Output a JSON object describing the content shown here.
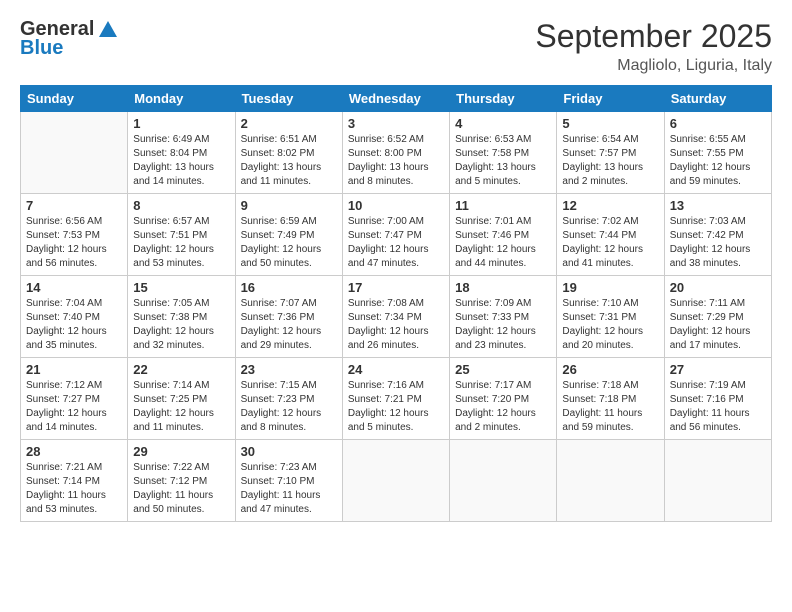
{
  "app": {
    "logo_general": "General",
    "logo_blue": "Blue",
    "month": "September 2025",
    "location": "Magliolo, Liguria, Italy"
  },
  "days_of_week": [
    "Sunday",
    "Monday",
    "Tuesday",
    "Wednesday",
    "Thursday",
    "Friday",
    "Saturday"
  ],
  "weeks": [
    [
      {
        "day": "",
        "info": ""
      },
      {
        "day": "1",
        "info": "Sunrise: 6:49 AM\nSunset: 8:04 PM\nDaylight: 13 hours\nand 14 minutes."
      },
      {
        "day": "2",
        "info": "Sunrise: 6:51 AM\nSunset: 8:02 PM\nDaylight: 13 hours\nand 11 minutes."
      },
      {
        "day": "3",
        "info": "Sunrise: 6:52 AM\nSunset: 8:00 PM\nDaylight: 13 hours\nand 8 minutes."
      },
      {
        "day": "4",
        "info": "Sunrise: 6:53 AM\nSunset: 7:58 PM\nDaylight: 13 hours\nand 5 minutes."
      },
      {
        "day": "5",
        "info": "Sunrise: 6:54 AM\nSunset: 7:57 PM\nDaylight: 13 hours\nand 2 minutes."
      },
      {
        "day": "6",
        "info": "Sunrise: 6:55 AM\nSunset: 7:55 PM\nDaylight: 12 hours\nand 59 minutes."
      }
    ],
    [
      {
        "day": "7",
        "info": "Sunrise: 6:56 AM\nSunset: 7:53 PM\nDaylight: 12 hours\nand 56 minutes."
      },
      {
        "day": "8",
        "info": "Sunrise: 6:57 AM\nSunset: 7:51 PM\nDaylight: 12 hours\nand 53 minutes."
      },
      {
        "day": "9",
        "info": "Sunrise: 6:59 AM\nSunset: 7:49 PM\nDaylight: 12 hours\nand 50 minutes."
      },
      {
        "day": "10",
        "info": "Sunrise: 7:00 AM\nSunset: 7:47 PM\nDaylight: 12 hours\nand 47 minutes."
      },
      {
        "day": "11",
        "info": "Sunrise: 7:01 AM\nSunset: 7:46 PM\nDaylight: 12 hours\nand 44 minutes."
      },
      {
        "day": "12",
        "info": "Sunrise: 7:02 AM\nSunset: 7:44 PM\nDaylight: 12 hours\nand 41 minutes."
      },
      {
        "day": "13",
        "info": "Sunrise: 7:03 AM\nSunset: 7:42 PM\nDaylight: 12 hours\nand 38 minutes."
      }
    ],
    [
      {
        "day": "14",
        "info": "Sunrise: 7:04 AM\nSunset: 7:40 PM\nDaylight: 12 hours\nand 35 minutes."
      },
      {
        "day": "15",
        "info": "Sunrise: 7:05 AM\nSunset: 7:38 PM\nDaylight: 12 hours\nand 32 minutes."
      },
      {
        "day": "16",
        "info": "Sunrise: 7:07 AM\nSunset: 7:36 PM\nDaylight: 12 hours\nand 29 minutes."
      },
      {
        "day": "17",
        "info": "Sunrise: 7:08 AM\nSunset: 7:34 PM\nDaylight: 12 hours\nand 26 minutes."
      },
      {
        "day": "18",
        "info": "Sunrise: 7:09 AM\nSunset: 7:33 PM\nDaylight: 12 hours\nand 23 minutes."
      },
      {
        "day": "19",
        "info": "Sunrise: 7:10 AM\nSunset: 7:31 PM\nDaylight: 12 hours\nand 20 minutes."
      },
      {
        "day": "20",
        "info": "Sunrise: 7:11 AM\nSunset: 7:29 PM\nDaylight: 12 hours\nand 17 minutes."
      }
    ],
    [
      {
        "day": "21",
        "info": "Sunrise: 7:12 AM\nSunset: 7:27 PM\nDaylight: 12 hours\nand 14 minutes."
      },
      {
        "day": "22",
        "info": "Sunrise: 7:14 AM\nSunset: 7:25 PM\nDaylight: 12 hours\nand 11 minutes."
      },
      {
        "day": "23",
        "info": "Sunrise: 7:15 AM\nSunset: 7:23 PM\nDaylight: 12 hours\nand 8 minutes."
      },
      {
        "day": "24",
        "info": "Sunrise: 7:16 AM\nSunset: 7:21 PM\nDaylight: 12 hours\nand 5 minutes."
      },
      {
        "day": "25",
        "info": "Sunrise: 7:17 AM\nSunset: 7:20 PM\nDaylight: 12 hours\nand 2 minutes."
      },
      {
        "day": "26",
        "info": "Sunrise: 7:18 AM\nSunset: 7:18 PM\nDaylight: 11 hours\nand 59 minutes."
      },
      {
        "day": "27",
        "info": "Sunrise: 7:19 AM\nSunset: 7:16 PM\nDaylight: 11 hours\nand 56 minutes."
      }
    ],
    [
      {
        "day": "28",
        "info": "Sunrise: 7:21 AM\nSunset: 7:14 PM\nDaylight: 11 hours\nand 53 minutes."
      },
      {
        "day": "29",
        "info": "Sunrise: 7:22 AM\nSunset: 7:12 PM\nDaylight: 11 hours\nand 50 minutes."
      },
      {
        "day": "30",
        "info": "Sunrise: 7:23 AM\nSunset: 7:10 PM\nDaylight: 11 hours\nand 47 minutes."
      },
      {
        "day": "",
        "info": ""
      },
      {
        "day": "",
        "info": ""
      },
      {
        "day": "",
        "info": ""
      },
      {
        "day": "",
        "info": ""
      }
    ]
  ]
}
